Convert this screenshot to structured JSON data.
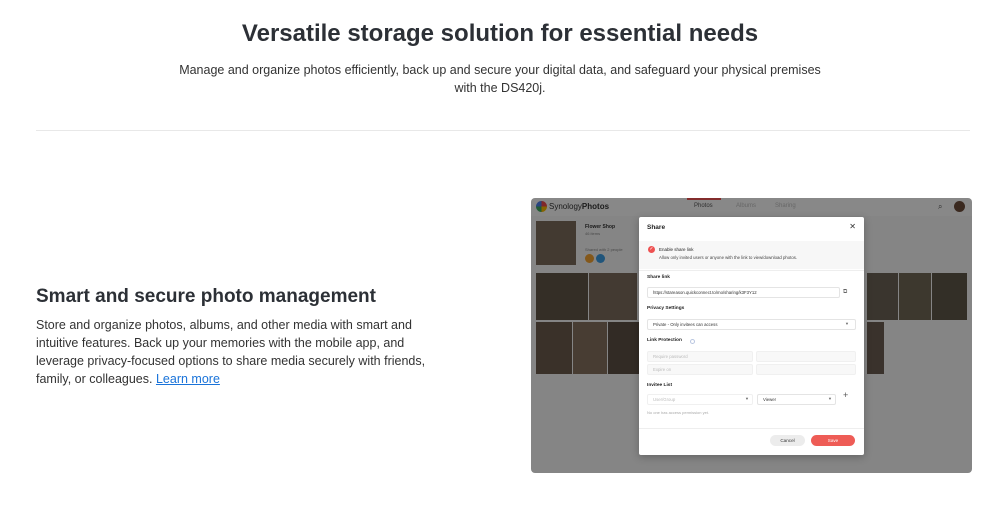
{
  "hero": {
    "title": "Versatile storage solution for essential needs",
    "subtitle": "Manage and organize photos efficiently, back up and secure your digital data, and safeguard your physical premises with the DS420j."
  },
  "feature": {
    "title": "Smart and secure photo management",
    "body": "Store and organize photos, albums, and other media with smart and intuitive features. Back up your memories with the mobile app, and leverage privacy-focused options to share media securely with friends, family, or colleagues. ",
    "link": "Learn more"
  },
  "app": {
    "brand_prefix": "Synology",
    "brand_name": "Photos",
    "nav": [
      "Photos",
      "Albums",
      "Sharing"
    ],
    "album": {
      "name": "Flower Shop",
      "meta": "46 items",
      "meta2": "Shared with 2 people"
    },
    "accent": "#ee5151"
  },
  "dialog": {
    "title": "Share",
    "enable_label": "Enable share link",
    "enable_desc": "Allow only invited users or anyone with the link to view/download photos.",
    "share_link_label": "Share link",
    "share_link_value": "https://stareason.quickconnect.to/mo/sharing/k3F3Y12",
    "privacy_label": "Privacy Settings",
    "privacy_value": "Private - Only invitees can access",
    "link_protection_label": "Link Protection",
    "require_password": "Require password",
    "expire_on": "Expire on",
    "invitee_label": "Invitee List",
    "invitee_placeholder": "User/Group",
    "role_value": "Viewer",
    "no_access": "No one has access permission yet.",
    "cancel": "Cancel",
    "save": "Save"
  }
}
